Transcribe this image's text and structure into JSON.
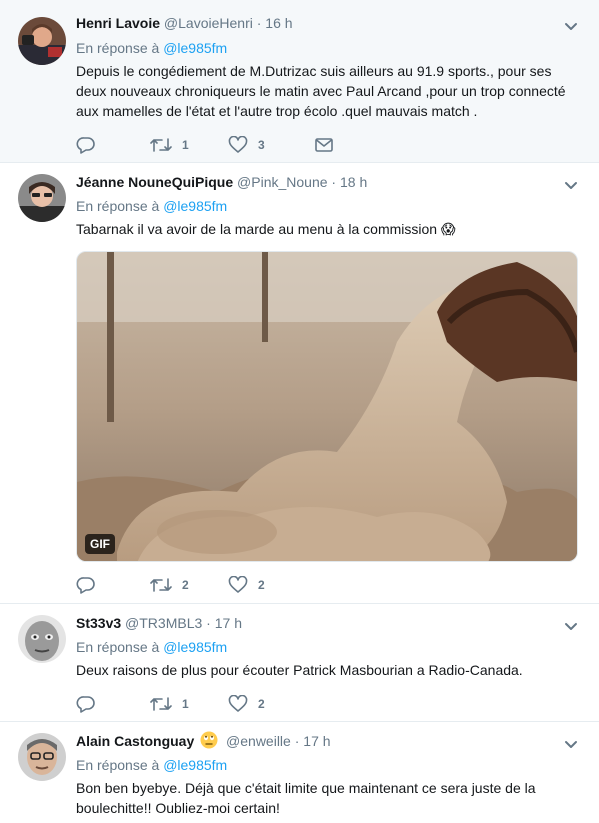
{
  "tweets": [
    {
      "name": "Henri Lavoie",
      "handle": "@LavoieHenri",
      "time": "16 h",
      "reply_prefix": "En réponse à",
      "reply_to": "@le985fm",
      "text": "Depuis le congédiement de M.Dutrizac suis ailleurs au 91.9 sports., pour ses deux nouveaux chroniqueurs  le matin avec Paul Arcand ,pour un trop connecté aux mamelles de l'état et l'autre trop écolo .quel mauvais match .",
      "retweets": "1",
      "likes": "3"
    },
    {
      "name": "Jéanne NouneQuiPique",
      "handle": "@Pink_Noune",
      "time": "18 h",
      "reply_prefix": "En réponse à",
      "reply_to": "@le985fm",
      "text": "Tabarnak il va avoir de la marde au menu à la commission",
      "emoji": "😱",
      "gif_label": "GIF",
      "retweets": "2",
      "likes": "2"
    },
    {
      "name": "St33v3",
      "handle": "@TR3MBL3",
      "time": "17 h",
      "reply_prefix": "En réponse à",
      "reply_to": "@le985fm",
      "text": "Deux raisons de plus pour écouter  Patrick Masbourian a Radio-Canada.",
      "retweets": "1",
      "likes": "2"
    },
    {
      "name": "Alain Castonguay",
      "name_emoji": "🙄",
      "handle": "@enweille",
      "time": "17 h",
      "reply_prefix": "En réponse à",
      "reply_to": "@le985fm",
      "text": "Bon ben byebye. Déjà que c'était limite que maintenant ce sera juste de la boulechitte!! Oubliez-moi certain!"
    }
  ],
  "separator": "·",
  "colors": {
    "accent": "#1da1f2",
    "secondary_text": "#657786",
    "highlight_bg": "#f5f8fa"
  },
  "icons": [
    "reply-icon",
    "retweet-icon",
    "like-icon",
    "dm-icon",
    "chevron-down-icon"
  ]
}
